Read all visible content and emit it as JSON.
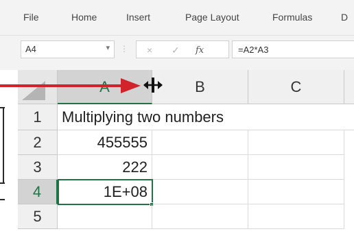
{
  "ribbon": {
    "tabs": [
      {
        "label": "File"
      },
      {
        "label": "Home"
      },
      {
        "label": "Insert"
      },
      {
        "label": "Page Layout"
      },
      {
        "label": "Formulas"
      },
      {
        "label": "D"
      }
    ]
  },
  "formula_bar": {
    "name_box": "A4",
    "cancel_icon": "×",
    "confirm_icon": "✓",
    "fx_label": "fx",
    "formula": "=A2*A3"
  },
  "sheet": {
    "columns": [
      "A",
      "B",
      "C"
    ],
    "selected_column": "A",
    "rows": [
      {
        "num": "1",
        "a": "Multiplying two numbers",
        "b": "",
        "c": ""
      },
      {
        "num": "2",
        "a": "455555",
        "b": "",
        "c": ""
      },
      {
        "num": "3",
        "a": "222",
        "b": "",
        "c": ""
      },
      {
        "num": "4",
        "a": "1E+08",
        "b": "",
        "c": ""
      },
      {
        "num": "5",
        "a": "",
        "b": "",
        "c": ""
      }
    ],
    "active_cell": "A4"
  },
  "annotation": {
    "arrow_color": "#d0232b",
    "cursor_icon": "column-resize-cursor-icon"
  },
  "colors": {
    "excel_green": "#217346",
    "header_bg": "#f0f0f0",
    "selected_header_bg": "#d3d3d3"
  }
}
